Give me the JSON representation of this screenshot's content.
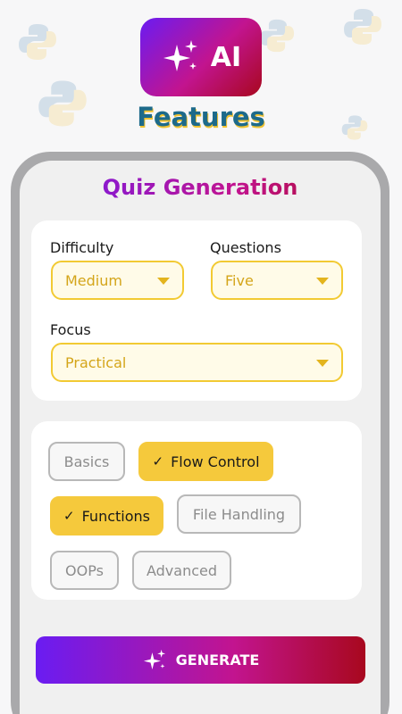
{
  "header": {
    "badge_text": "AI",
    "features_title": "Features"
  },
  "quiz": {
    "title": "Quiz Generation",
    "difficulty": {
      "label": "Difficulty",
      "value": "Medium"
    },
    "questions": {
      "label": "Questions",
      "value": "Five"
    },
    "focus": {
      "label": "Focus",
      "value": "Practical"
    }
  },
  "topics": [
    {
      "label": "Basics",
      "selected": false
    },
    {
      "label": "Flow Control",
      "selected": true
    },
    {
      "label": "Functions",
      "selected": true
    },
    {
      "label": "File Handling",
      "selected": false
    },
    {
      "label": "OOPs",
      "selected": false
    },
    {
      "label": "Advanced",
      "selected": false
    }
  ],
  "generate_button": {
    "label": "GENERATE"
  },
  "icons": {
    "sparkle": "sparkles-icon",
    "check": "check-icon",
    "caret": "chevron-down-icon",
    "background": "python-logo-icon"
  },
  "colors": {
    "gradient_start": "#6a1cf2",
    "gradient_mid": "#c2148f",
    "gradient_end": "#a8081e",
    "accent_yellow": "#f5c93c",
    "title_blue": "#1d6a8a"
  }
}
